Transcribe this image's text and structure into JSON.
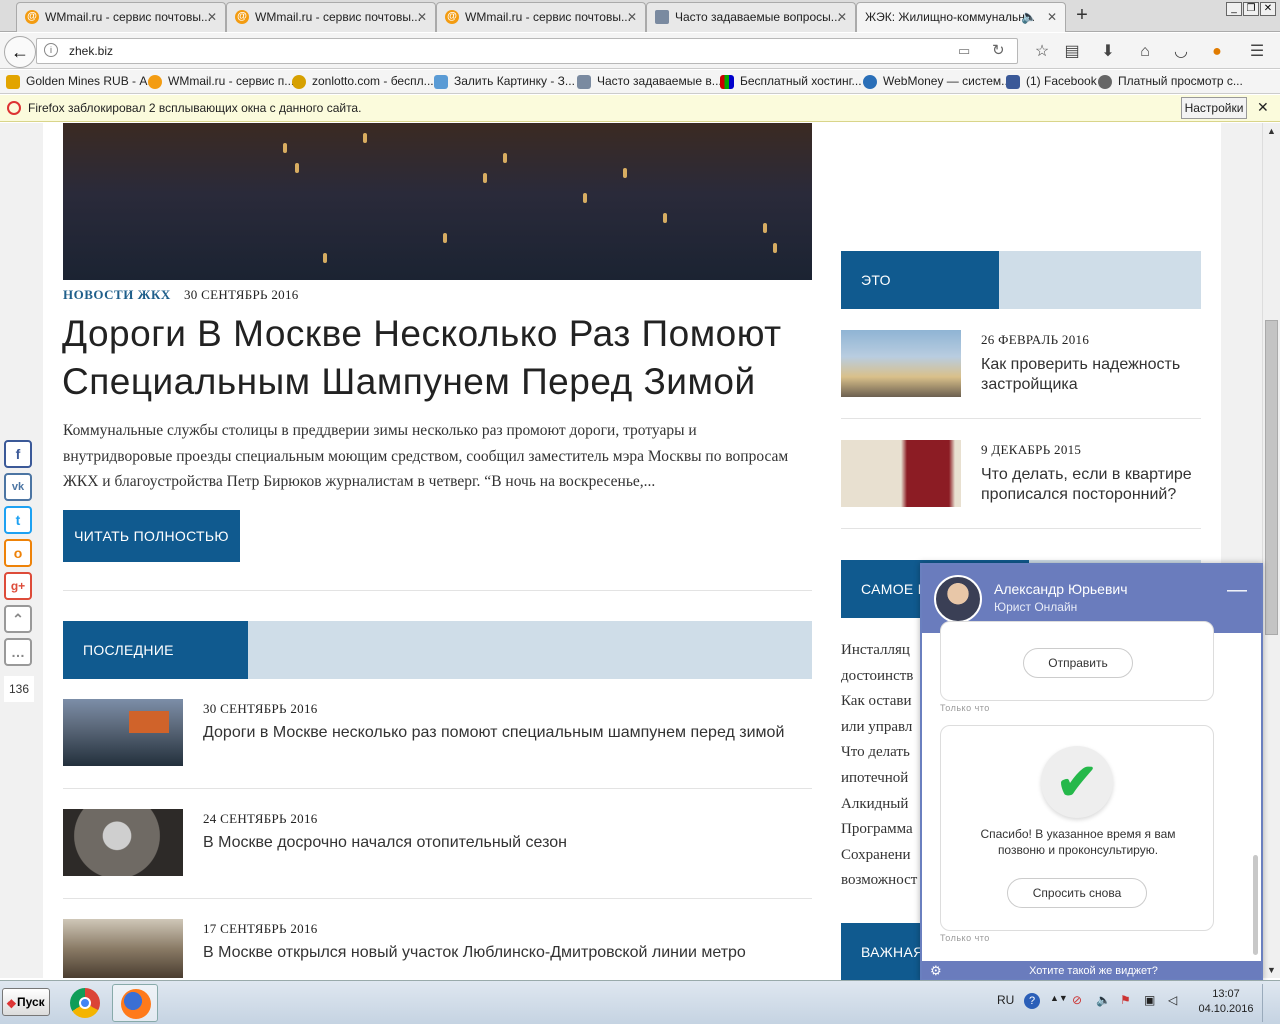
{
  "browser": {
    "tabs": [
      {
        "label": "WMmail.ru - сервис почтовы...",
        "active": false
      },
      {
        "label": "WMmail.ru - сервис почтовы...",
        "active": false
      },
      {
        "label": "WMmail.ru - сервис почтовы...",
        "active": false
      },
      {
        "label": "Часто задаваемые вопросы...",
        "active": false
      },
      {
        "label": "ЖЭК: Жилищно-коммунальн...",
        "active": true
      }
    ],
    "url": "zhek.biz",
    "bookmarks": [
      "Golden Mines RUB - А...",
      "WMmail.ru - сервис п...",
      "zonlotto.com - беспл...",
      "Залить Картинку - З...",
      "Часто задаваемые в...",
      "Бесплатный хостинг...",
      "WebMoney — систем...",
      "(1) Facebook",
      "Платный просмотр с..."
    ],
    "notification": {
      "text": "Firefox заблокировал 2 всплывающих окна с данного сайта.",
      "button": "Настройки"
    }
  },
  "article": {
    "category": "НОВОСТИ ЖКХ",
    "date": "30 СЕНТЯБРЬ 2016",
    "title": "Дороги В Москве Несколько Раз Помоют Специальным Шампунем Перед Зимой",
    "excerpt": "Коммунальные службы столицы в преддверии зимы несколько раз промоют дороги, тротуары и внутридворовые проезды специальным моющим средством, сообщил заместитель мэра Москвы по вопросам ЖКХ и благоустройства Петр Бирюков журналистам в четверг. “В ночь на воскресенье,...",
    "read_more": "ЧИТАТЬ ПОЛНОСТЬЮ"
  },
  "recent": {
    "heading": "ПОСЛЕДНИЕ ЗАПИСИ",
    "items": [
      {
        "date": "30 СЕНТЯБРЬ 2016",
        "title": "Дороги в Москве несколько раз помоют специальным шампунем перед зимой"
      },
      {
        "date": "24 СЕНТЯБРЬ 2016",
        "title": "В Москве досрочно начался отопительный сезон"
      },
      {
        "date": "17 СЕНТЯБРЬ 2016",
        "title": "В Москве открылся новый участок Люблинско-Дмитровской линии метро"
      }
    ]
  },
  "sidebar": {
    "interesting_heading": "ЭТО ИНТЕРЕСНО",
    "interesting": [
      {
        "date": "26 ФЕВРАЛЬ 2016",
        "title": "Как проверить надежность застройщика"
      },
      {
        "date": "9 ДЕКАБРЬ 2015",
        "title": "Что делать, если в квартире прописался посторонний?"
      }
    ],
    "popular_heading": "САМОЕ П",
    "popular_lines": [
      "Инсталляц",
      "достоинств",
      "Как остави",
      "или управл",
      "Что делать",
      "ипотечной",
      "Алкидный",
      "Программа",
      "Сохранени",
      "возможност"
    ],
    "important_heading": "ВАЖНАЯ"
  },
  "social": {
    "icons": [
      "facebook-icon",
      "vk-icon",
      "twitter-icon",
      "odnoklassniki-icon",
      "google-plus-icon",
      "scroll-up-icon",
      "more-icon"
    ],
    "count": "136"
  },
  "chat": {
    "agent_name": "Александр Юрьевич",
    "agent_role": "Юрист Онлайн",
    "send_button": "Отправить",
    "timestamp1": "Только что",
    "thanks": "Спасибо! В указанное время я вам позвоню и проконсультирую.",
    "ask_again": "Спросить снова",
    "timestamp2": "Только что",
    "footer": "Хотите такой же виджет?"
  },
  "taskbar": {
    "start": "Пуск",
    "lang": "RU",
    "time": "13:07",
    "date": "04.10.2016"
  },
  "colors": {
    "brand_blue": "#105a8f",
    "section_bg": "#cfdde8",
    "chat_purple": "#6a7cbd"
  }
}
